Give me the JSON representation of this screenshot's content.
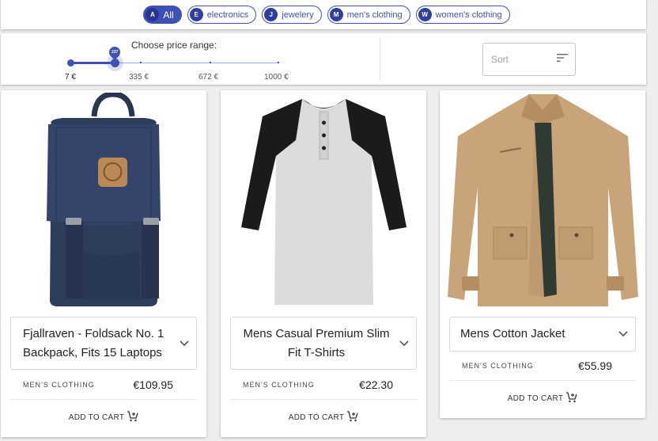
{
  "categories": [
    {
      "avatar": "A",
      "label": "All",
      "selected": true
    },
    {
      "avatar": "E",
      "label": "electronics",
      "selected": false
    },
    {
      "avatar": "J",
      "label": "jewelery",
      "selected": false
    },
    {
      "avatar": "M",
      "label": "men's clothing",
      "selected": false
    },
    {
      "avatar": "W",
      "label": "women's clothing",
      "selected": false
    }
  ],
  "filter": {
    "price_label": "Choose price range:",
    "slider": {
      "min": 7,
      "max": 1000,
      "range": [
        7,
        237
      ],
      "value_label": "237"
    },
    "ticks": [
      "7 €",
      "335 €",
      "672 €",
      "1000 €"
    ],
    "sort_placeholder": "Sort",
    "sort_icon": "sort-icon"
  },
  "products": [
    {
      "title": "Fjallraven - Foldsack No. 1 Backpack, Fits 15 Laptops",
      "category": "MEN'S CLOTHING",
      "price": "€109.95",
      "add_to_cart": "ADD TO CART",
      "image": "backpack"
    },
    {
      "title": "Mens Casual Premium Slim Fit T-Shirts",
      "category": "MEN'S CLOTHING",
      "price": "€22.30",
      "add_to_cart": "ADD TO CART",
      "image": "t-shirt"
    },
    {
      "title": "Mens Cotton Jacket",
      "category": "MEN'S CLOTHING",
      "price": "€55.99",
      "add_to_cart": "ADD TO CART",
      "image": "jacket"
    }
  ],
  "colors": {
    "primary": "#3f51b5",
    "background": "#eeeeee",
    "card": "#ffffff"
  }
}
